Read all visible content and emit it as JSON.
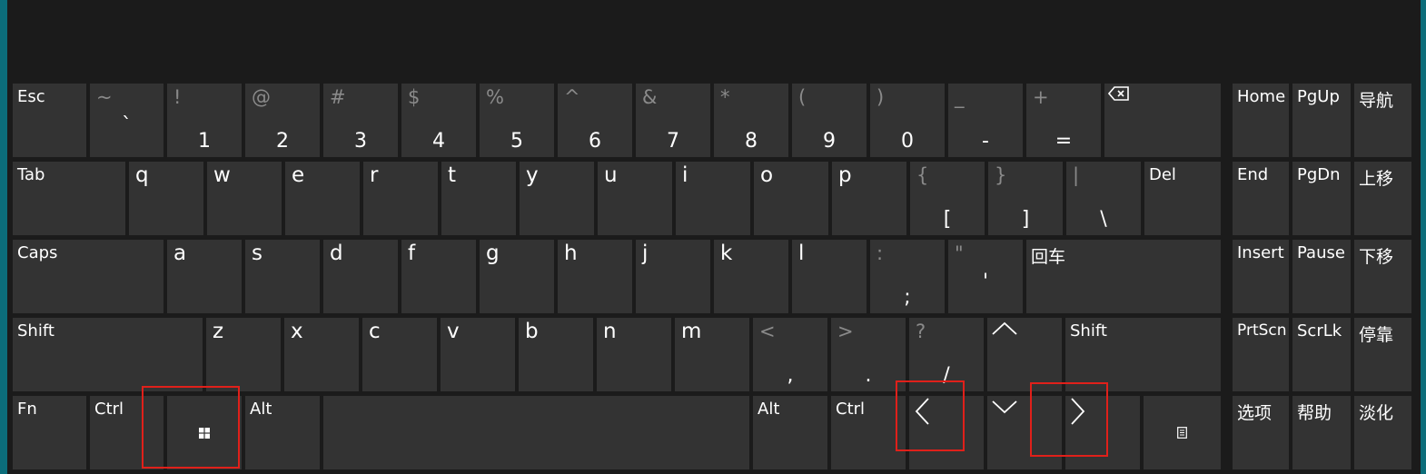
{
  "colors": {
    "background": "#1b1b1b",
    "key": "#333333",
    "key_text": "#ffffff",
    "secondary_text": "#8a8a8a",
    "highlight": "#e0201a",
    "edge": "#0c6d7a"
  },
  "keys": {
    "esc": "Esc",
    "tilde_shift": "~",
    "tilde_main": "`",
    "n1_shift": "!",
    "n1_main": "1",
    "n2_shift": "@",
    "n2_main": "2",
    "n3_shift": "#",
    "n3_main": "3",
    "n4_shift": "$",
    "n4_main": "4",
    "n5_shift": "%",
    "n5_main": "5",
    "n6_shift": "^",
    "n6_main": "6",
    "n7_shift": "&",
    "n7_main": "7",
    "n8_shift": "*",
    "n8_main": "8",
    "n9_shift": "(",
    "n9_main": "9",
    "n0_shift": ")",
    "n0_main": "0",
    "minus_shift": "_",
    "minus_main": "-",
    "equal_shift": "+",
    "equal_main": "=",
    "backspace_icon": "backspace-icon",
    "tab": "Tab",
    "q": "q",
    "w": "w",
    "e": "e",
    "r": "r",
    "t": "t",
    "y": "y",
    "u": "u",
    "i": "i",
    "o": "o",
    "p": "p",
    "lbracket_shift": "{",
    "lbracket_main": "[",
    "rbracket_shift": "}",
    "rbracket_main": "]",
    "backslash_shift": "|",
    "backslash_main": "\\",
    "del": "Del",
    "caps": "Caps",
    "a": "a",
    "s": "s",
    "d": "d",
    "f": "f",
    "g": "g",
    "h": "h",
    "j": "j",
    "k": "k",
    "l": "l",
    "semicolon_shift": ":",
    "semicolon_main": ";",
    "quote_shift": "\"",
    "quote_main": "'",
    "enter": "回车",
    "shift_left": "Shift",
    "z": "z",
    "x": "x",
    "c": "c",
    "v": "v",
    "b": "b",
    "n": "n",
    "m": "m",
    "comma_shift": "<",
    "comma_main": ",",
    "period_shift": ">",
    "period_main": ".",
    "slash_shift": "?",
    "slash_main": "/",
    "shift_right": "Shift",
    "fn": "Fn",
    "ctrl_left": "Ctrl",
    "alt_left": "Alt",
    "alt_right": "Alt",
    "ctrl_right": "Ctrl",
    "home": "Home",
    "pgup": "PgUp",
    "nav": "导航",
    "end": "End",
    "pgdn": "PgDn",
    "move_up": "上移",
    "insert": "Insert",
    "pause": "Pause",
    "move_down": "下移",
    "prtscn": "PrtScn",
    "scrlk": "ScrLk",
    "dock": "停靠",
    "options": "选项",
    "help": "帮助",
    "fade": "淡化"
  }
}
